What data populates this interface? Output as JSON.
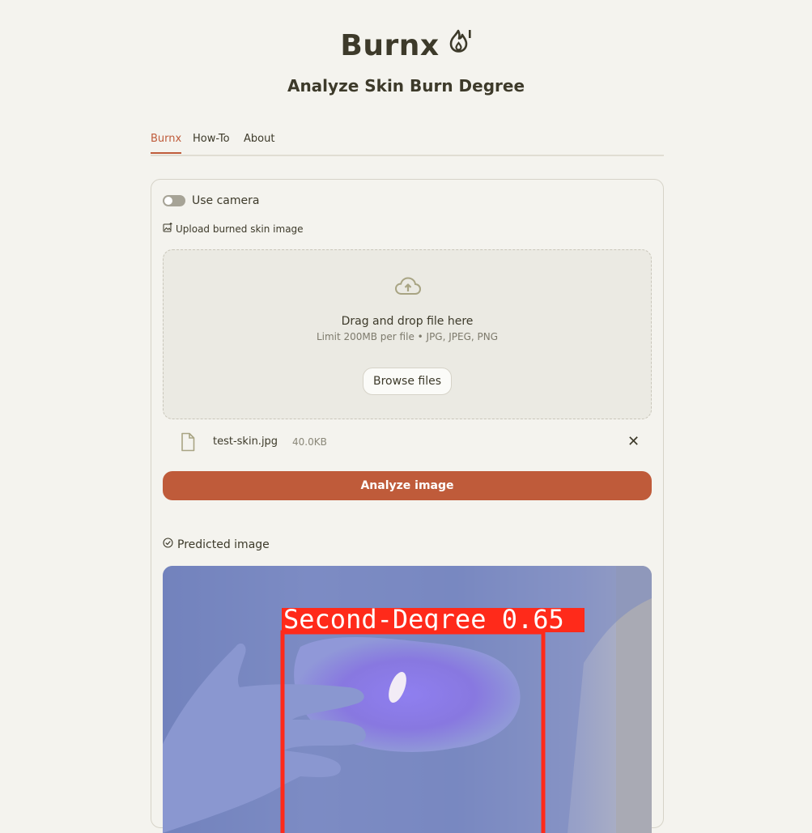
{
  "header": {
    "title": "Burnx",
    "logo_icon": "flame-icon",
    "subtitle": "Analyze Skin Burn Degree"
  },
  "tabs": [
    {
      "label": "Burnx",
      "active": true
    },
    {
      "label": "How-To",
      "active": false
    },
    {
      "label": "About",
      "active": false
    }
  ],
  "camera": {
    "label": "Use camera",
    "enabled": false
  },
  "upload": {
    "label": "Upload burned skin image",
    "icon": "image-upload-icon",
    "dropzone_title": "Drag and drop file here",
    "dropzone_limit": "Limit 200MB per file • JPG, JPEG, PNG",
    "browse_label": "Browse files"
  },
  "file": {
    "name": "test-skin.jpg",
    "size": "40.0KB"
  },
  "analyze_label": "Analyze image",
  "prediction": {
    "label": "Predicted image",
    "detection_label": "Second-Degree 0.65"
  },
  "colors": {
    "accent": "#bf5b3a",
    "background": "#f4f3ee",
    "text": "#3d3a2a",
    "detection_box": "#ff2a1a"
  }
}
